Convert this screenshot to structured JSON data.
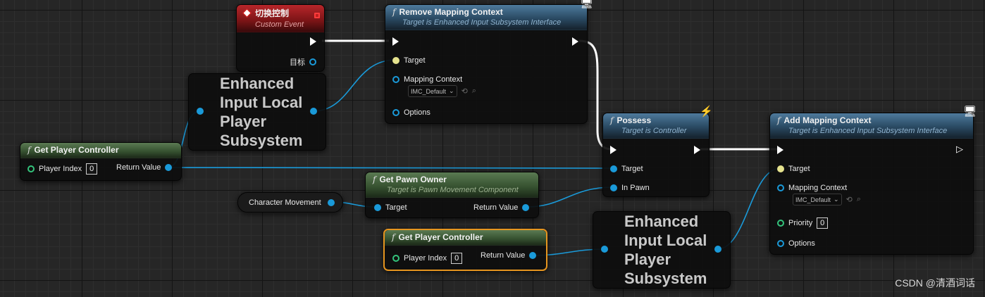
{
  "custom_event": {
    "title": "切换控制",
    "subtitle": "Custom Event",
    "target_label": "目标"
  },
  "remove_mapping": {
    "title": "Remove Mapping Context",
    "subtitle": "Target is Enhanced Input Subsystem Interface",
    "target_label": "Target",
    "mapping_label": "Mapping Context",
    "mapping_value": "IMC_Default",
    "options_label": "Options"
  },
  "subsystem_1": {
    "lines": [
      "Enhanced",
      "Input Local",
      "Player",
      "Subsystem"
    ]
  },
  "get_pc_1": {
    "title": "Get Player Controller",
    "player_index_label": "Player Index",
    "player_index_value": "0",
    "return_label": "Return Value"
  },
  "get_pawn_owner": {
    "title": "Get Pawn Owner",
    "subtitle": "Target is Pawn Movement Component",
    "target_label": "Target",
    "return_label": "Return Value"
  },
  "char_movement": {
    "label": "Character Movement"
  },
  "get_pc_2": {
    "title": "Get Player Controller",
    "player_index_label": "Player Index",
    "player_index_value": "0",
    "return_label": "Return Value"
  },
  "possess": {
    "title": "Possess",
    "subtitle": "Target is Controller",
    "target_label": "Target",
    "in_pawn_label": "In Pawn"
  },
  "subsystem_2": {
    "lines": [
      "Enhanced",
      "Input Local",
      "Player",
      "Subsystem"
    ]
  },
  "add_mapping": {
    "title": "Add Mapping Context",
    "subtitle": "Target is Enhanced Input Subsystem Interface",
    "target_label": "Target",
    "mapping_label": "Mapping Context",
    "mapping_value": "IMC_Default",
    "priority_label": "Priority",
    "priority_value": "0",
    "options_label": "Options"
  },
  "icons": {
    "function": "f",
    "dropdown": "chevron-down-icon",
    "reset": "reset-arrow-icon",
    "browse": "search-icon",
    "net": "monitor-icon"
  },
  "colors": {
    "exec": "#ffffff",
    "object_pin": "#1a9ad9",
    "int_pin": "#34c47c",
    "self_pin": "#e6e38e",
    "selected": "#e6951f",
    "event_header": "#b8262a",
    "function_header": "#2a4a63",
    "pure_header": "#35502f"
  },
  "watermark": "CSDN @清酒词话"
}
